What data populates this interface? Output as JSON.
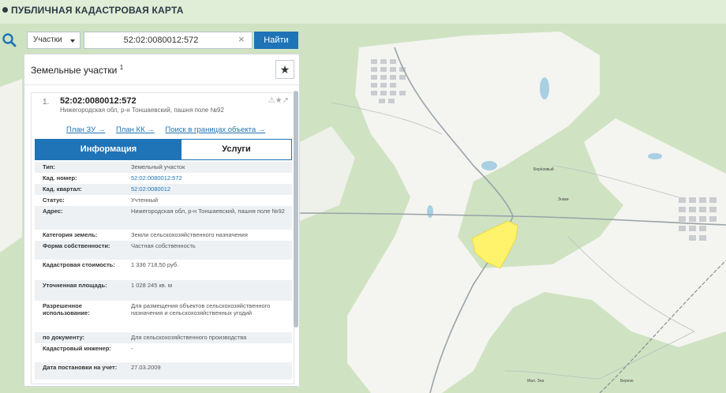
{
  "app": {
    "title": "ПУБЛИЧНАЯ КАДАСТРОВАЯ КАРТА"
  },
  "search": {
    "type_selected": "Участки",
    "query": "52:02:0080012:572",
    "clear_glyph": "×",
    "button_label": "Найти"
  },
  "panel": {
    "title": "Земельные участки",
    "count_sup": "1",
    "star_glyph": "★"
  },
  "result": {
    "index": "1.",
    "cad_number": "52:02:0080012:572",
    "address_short": "Нижегородская обл, р-н Тоншаевский, пашня поле №92",
    "tools": "⚠★↗",
    "links": [
      "План ЗУ →",
      "План КК →",
      "Поиск в границах объекта →"
    ]
  },
  "tabs": {
    "info": "Информация",
    "services": "Услуги"
  },
  "properties": [
    {
      "label": "Тип:",
      "value": "Земельный участок"
    },
    {
      "label": "Кад. номер:",
      "value": "52:02:0080012:572"
    },
    {
      "label": "Кад. квартал:",
      "value": "52:02:0080012"
    },
    {
      "label": "Статус:",
      "value": "Учтенный"
    },
    {
      "label": "Адрес:",
      "value": "Нижегородская обл, р-н Тоншаевский, пашня поле №92"
    },
    {
      "label": "Категория земель:",
      "value": "Земли сельскохозяйственного назначения"
    },
    {
      "label": "Форма собственности:",
      "value": "Частная собственность"
    },
    {
      "label": "Кадастровая стоимость:",
      "value": "1 336 718,50 руб."
    },
    {
      "label": "Уточненная площадь:",
      "value": "1 028 245 кв. м"
    },
    {
      "label": "Разрешенное использование:",
      "value": "Для размещения объектов сельскохозяйственного назначения и сельскохозяйственных угодий"
    },
    {
      "label": "по документу:",
      "value": "Для сельскохозяйственного производства"
    },
    {
      "label": "Кадастровый инженер:",
      "value": "-"
    },
    {
      "label": "Дата постановки на учет:",
      "value": "27.03.2009"
    }
  ],
  "map": {
    "labels": [
      "Берёзовый",
      "Знаки",
      "Мал. Зна",
      "Березо"
    ],
    "colors": {
      "forest": "#cfe3c2",
      "open": "#f4f4f0",
      "parcel": "#fff36b",
      "water": "#a9cfe3",
      "road": "#9aa3a8"
    }
  }
}
